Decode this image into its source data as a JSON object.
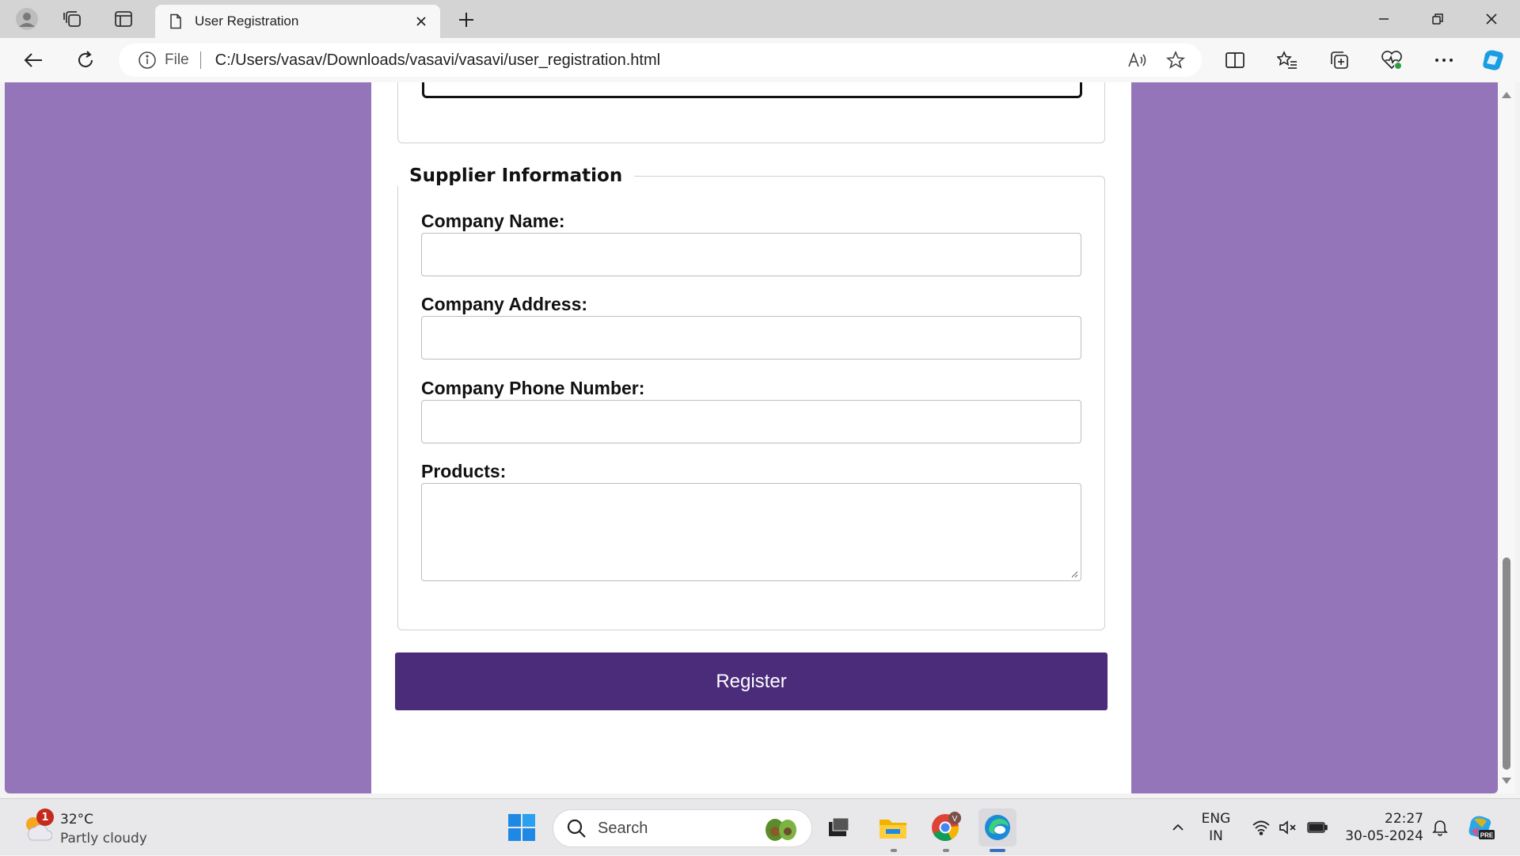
{
  "browser": {
    "tab_title": "User Registration",
    "address_scheme": "File",
    "address_url": "C:/Users/vasav/Downloads/vasavi/vasavi/user_registration.html"
  },
  "page": {
    "background_color": "#9575b9",
    "supplier_section": {
      "legend": "Supplier Information",
      "company_name_label": "Company Name:",
      "company_name_value": "",
      "company_address_label": "Company Address:",
      "company_address_value": "",
      "company_phone_label": "Company Phone Number:",
      "company_phone_value": "",
      "products_label": "Products:",
      "products_value": ""
    },
    "register_button": "Register",
    "register_color": "#4b2c7b"
  },
  "taskbar": {
    "weather_temp": "32°C",
    "weather_desc": "Partly cloudy",
    "weather_badge": "1",
    "search_label": "Search",
    "chrome_badge": "V",
    "lang_line1": "ENG",
    "lang_line2": "IN",
    "time": "22:27",
    "date": "30-05-2024",
    "copilot_badge": "PRE"
  }
}
